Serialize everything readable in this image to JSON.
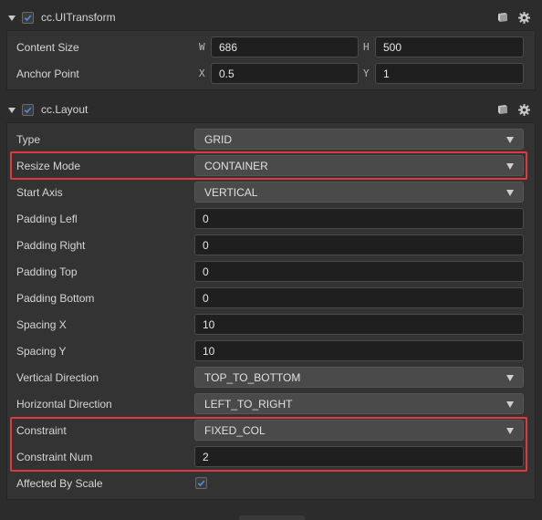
{
  "uitransform": {
    "title": "cc.UITransform",
    "enabled": true,
    "content_size": {
      "label": "Content Size",
      "w_label": "W",
      "w": "686",
      "h_label": "H",
      "h": "500"
    },
    "anchor_point": {
      "label": "Anchor Point",
      "x_label": "X",
      "x": "0.5",
      "y_label": "Y",
      "y": "1"
    }
  },
  "layout": {
    "title": "cc.Layout",
    "enabled": true,
    "type": {
      "label": "Type",
      "value": "GRID"
    },
    "resize_mode": {
      "label": "Resize Mode",
      "value": "CONTAINER"
    },
    "start_axis": {
      "label": "Start Axis",
      "value": "VERTICAL"
    },
    "padding_left": {
      "label": "Padding Lefl",
      "value": "0"
    },
    "padding_right": {
      "label": "Padding Right",
      "value": "0"
    },
    "padding_top": {
      "label": "Padding Top",
      "value": "0"
    },
    "padding_bottom": {
      "label": "Padding Bottom",
      "value": "0"
    },
    "spacing_x": {
      "label": "Spacing X",
      "value": "10"
    },
    "spacing_y": {
      "label": "Spacing Y",
      "value": "10"
    },
    "vertical_direction": {
      "label": "Vertical Direction",
      "value": "TOP_TO_BOTTOM"
    },
    "horizontal_direction": {
      "label": "Horizontal Direction",
      "value": "LEFT_TO_RIGHT"
    },
    "constraint": {
      "label": "Constraint",
      "value": "FIXED_COL"
    },
    "constraint_num": {
      "label": "Constraint Num",
      "value": "2"
    },
    "affected_by_scale": {
      "label": "Affected By Scale",
      "checked": true
    }
  },
  "icons": {
    "collapse": "triangle-down-icon",
    "enable": "checkbox-icon",
    "help": "book-icon",
    "settings": "gear-icon",
    "dropdown": "caret-down-icon"
  },
  "colors": {
    "highlight": "#e0383e",
    "checkbox_accent": "#4a8fe0"
  }
}
